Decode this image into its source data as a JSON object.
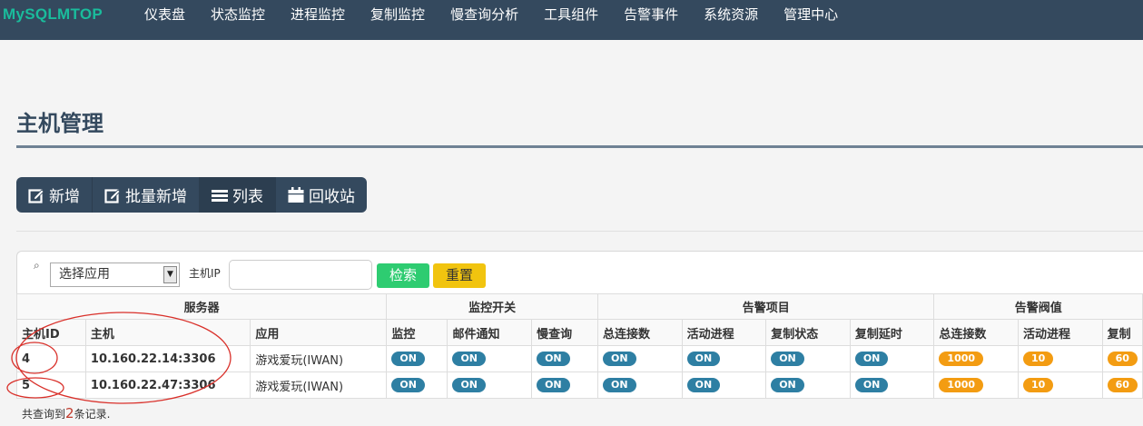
{
  "brand": "MySQLMTOP",
  "nav": [
    "仪表盘",
    "状态监控",
    "进程监控",
    "复制监控",
    "慢查询分析",
    "工具组件",
    "告警事件",
    "系统资源",
    "管理中心"
  ],
  "page_title": "主机管理",
  "toolbar": {
    "add": "新增",
    "batch_add": "批量新增",
    "list": "列表",
    "recycle": "回收站"
  },
  "search": {
    "select_value": "选择应用",
    "ip_label": "主机IP",
    "ip_value": "",
    "search_btn": "检索",
    "reset_btn": "重置"
  },
  "table": {
    "groups": [
      "服务器",
      "监控开关",
      "告警项目",
      "告警阀值"
    ],
    "columns": [
      "主机ID",
      "主机",
      "应用",
      "监控",
      "邮件通知",
      "慢查询",
      "总连接数",
      "活动进程",
      "复制状态",
      "复制延时",
      "总连接数",
      "活动进程",
      "复制"
    ],
    "rows": [
      {
        "id": "4",
        "host": "10.160.22.14:3306",
        "app": "游戏爱玩(IWAN)",
        "monitor": "ON",
        "mail": "ON",
        "slow": "ON",
        "a_conn": "ON",
        "a_proc": "ON",
        "a_repl": "ON",
        "a_delay": "ON",
        "t_conn": "1000",
        "t_proc": "10",
        "t_repl": "60"
      },
      {
        "id": "5",
        "host": "10.160.22.47:3306",
        "app": "游戏爱玩(IWAN)",
        "monitor": "ON",
        "mail": "ON",
        "slow": "ON",
        "a_conn": "ON",
        "a_proc": "ON",
        "a_repl": "ON",
        "a_delay": "ON",
        "t_conn": "1000",
        "t_proc": "10",
        "t_repl": "60"
      }
    ]
  },
  "footer": {
    "prefix": "共查询到",
    "count": "2",
    "suffix": "条记录."
  },
  "colors": {
    "nav_bg": "#34495e",
    "brand": "#1abc9c",
    "on_badge": "#2e7fa3",
    "threshold_badge": "#f39c12",
    "search_btn": "#2ecc71",
    "reset_btn": "#f1c40f",
    "annotation": "#d9302a"
  }
}
